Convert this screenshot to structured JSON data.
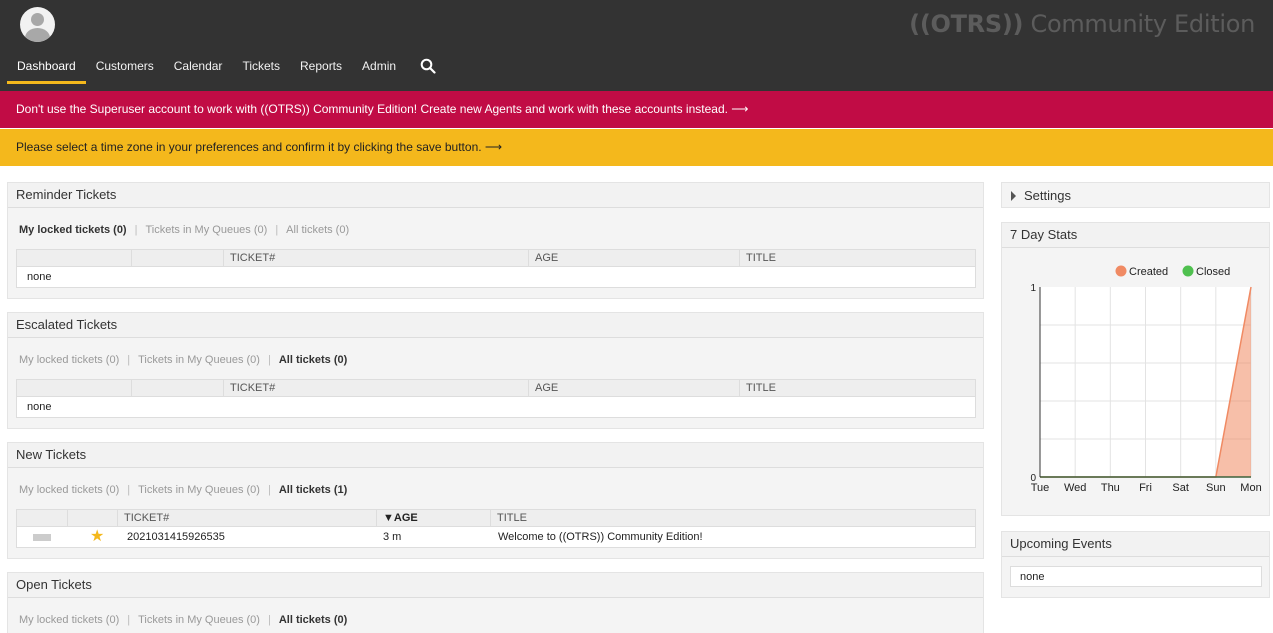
{
  "header": {
    "logo_mark": "((OTRS))",
    "logo_text": "Community Edition",
    "nav": [
      {
        "label": "Dashboard",
        "active": true
      },
      {
        "label": "Customers"
      },
      {
        "label": "Calendar"
      },
      {
        "label": "Tickets"
      },
      {
        "label": "Reports"
      },
      {
        "label": "Admin"
      }
    ],
    "search_icon": "search-icon"
  },
  "banners": {
    "superuser": "Don't use the Superuser account to work with ((OTRS)) Community Edition! Create new Agents and work with these accounts instead. ⟶",
    "timezone": "Please select a time zone in your preferences and confirm it by clicking the save button. ⟶"
  },
  "widgets": {
    "reminder": {
      "title": "Reminder Tickets",
      "filters": [
        "My locked tickets (0)",
        "Tickets in My Queues (0)",
        "All tickets (0)"
      ],
      "selected_filter": 0,
      "columns": [
        "",
        "",
        "TICKET#",
        "AGE",
        "TITLE"
      ],
      "empty": "none"
    },
    "escalated": {
      "title": "Escalated Tickets",
      "filters": [
        "My locked tickets (0)",
        "Tickets in My Queues (0)",
        "All tickets (0)"
      ],
      "selected_filter": 2,
      "columns": [
        "",
        "",
        "TICKET#",
        "AGE",
        "TITLE"
      ],
      "empty": "none"
    },
    "new": {
      "title": "New Tickets",
      "filters": [
        "My locked tickets (0)",
        "Tickets in My Queues (0)",
        "All tickets (1)"
      ],
      "selected_filter": 2,
      "columns": [
        "",
        "",
        "TICKET#",
        "▼AGE",
        "TITLE"
      ],
      "rows": [
        {
          "ticket": "2021031415926535",
          "age": "3 m",
          "title": "Welcome to ((OTRS)) Community Edition!",
          "starred": true
        }
      ]
    },
    "open": {
      "title": "Open Tickets",
      "filters": [
        "My locked tickets (0)",
        "Tickets in My Queues (0)",
        "All tickets (0)"
      ],
      "selected_filter": 2
    }
  },
  "sidebar": {
    "settings_label": "Settings",
    "stats_title": "7 Day Stats",
    "events_title": "Upcoming Events",
    "events_value": "none"
  },
  "colors": {
    "header_bg": "#333333",
    "accent": "#f4b81c",
    "banner_red": "#c10c45",
    "created": "#f08a63",
    "closed": "#4fc04f"
  },
  "chart_data": {
    "type": "area",
    "categories": [
      "Tue",
      "Wed",
      "Thu",
      "Fri",
      "Sat",
      "Sun",
      "Mon"
    ],
    "series": [
      {
        "name": "Created",
        "values": [
          0,
          0,
          0,
          0,
          0,
          0,
          1
        ]
      },
      {
        "name": "Closed",
        "values": [
          0,
          0,
          0,
          0,
          0,
          0,
          0
        ]
      }
    ],
    "ylim": [
      0,
      1
    ],
    "yticks": [
      "0",
      "1"
    ],
    "legend": "top-right",
    "grid": true
  }
}
